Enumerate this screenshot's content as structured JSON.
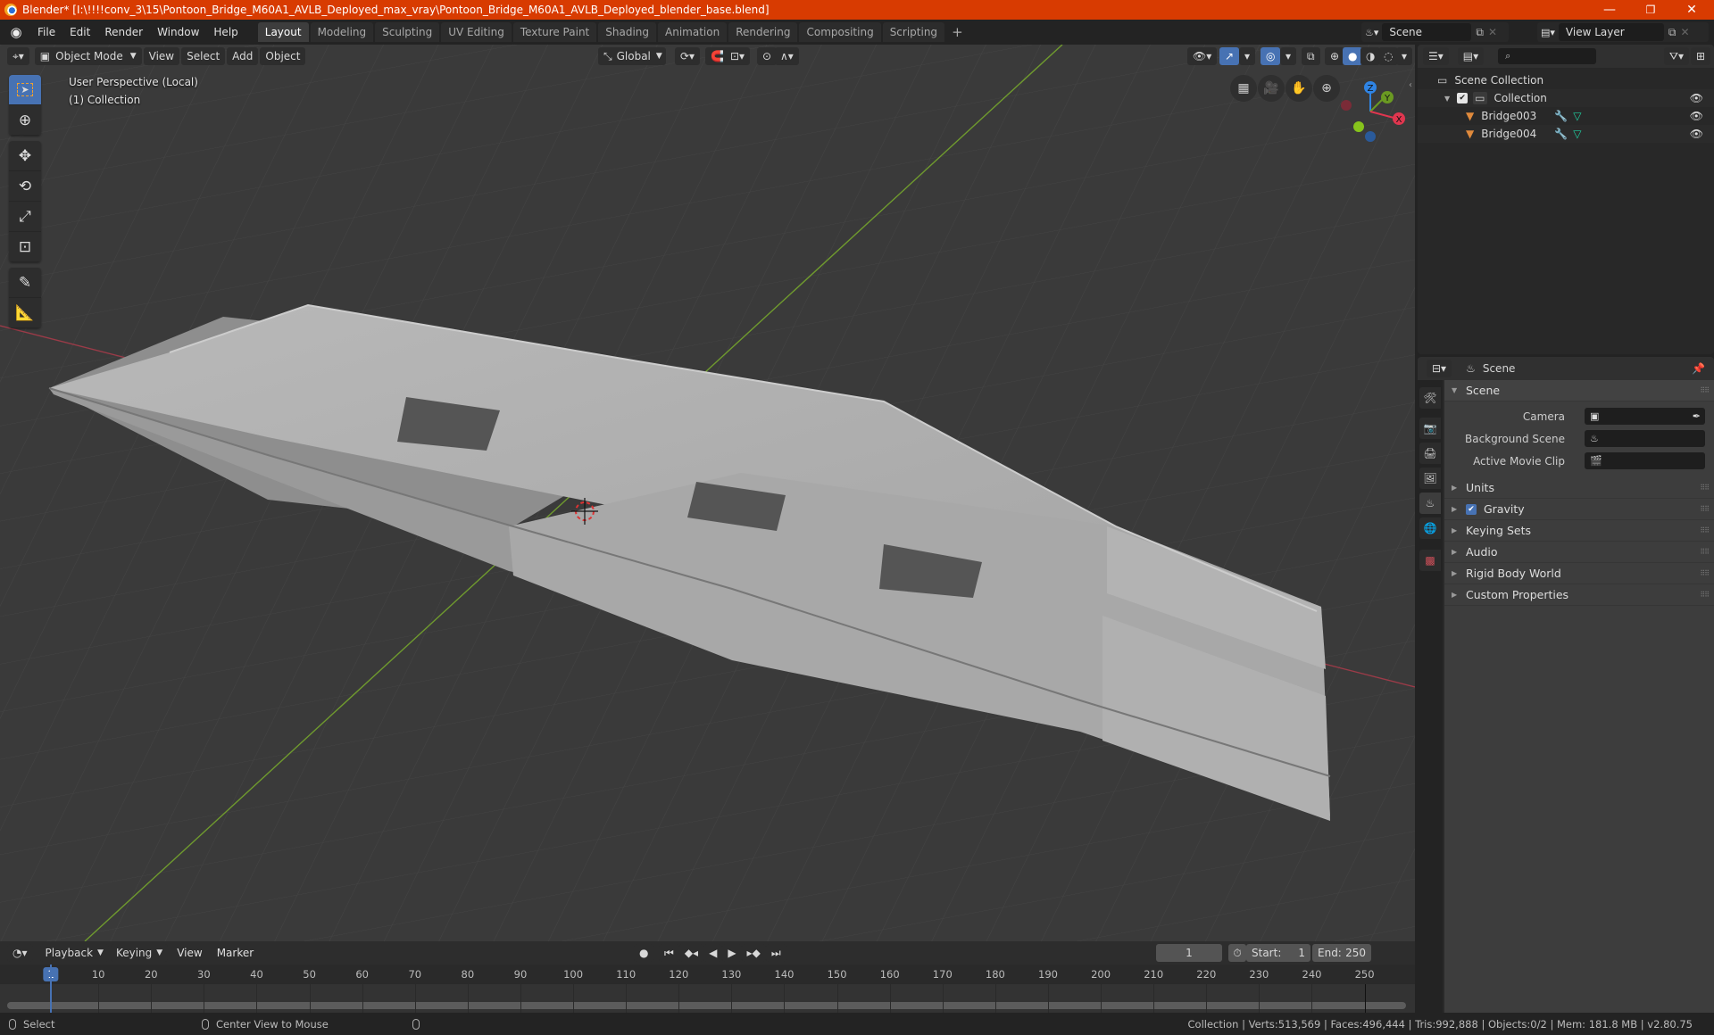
{
  "window": {
    "title": "Blender* [I:\\!!!!conv_3\\15\\Pontoon_Bridge_M60A1_AVLB_Deployed_max_vray\\Pontoon_Bridge_M60A1_AVLB_Deployed_blender_base.blend]",
    "controls": {
      "minimize": "—",
      "maximize": "❐",
      "close": "✕"
    }
  },
  "menubar": {
    "items": [
      "File",
      "Edit",
      "Render",
      "Window",
      "Help"
    ],
    "workspaces": [
      "Layout",
      "Modeling",
      "Sculpting",
      "UV Editing",
      "Texture Paint",
      "Shading",
      "Animation",
      "Rendering",
      "Compositing",
      "Scripting"
    ],
    "active_workspace": "Layout",
    "add_workspace": "+",
    "scene": "Scene",
    "view_layer": "View Layer"
  },
  "viewport": {
    "header": {
      "mode": "Object Mode",
      "menus": [
        "View",
        "Select",
        "Add",
        "Object"
      ],
      "transform_orientation": "Global"
    },
    "overlay": {
      "view_name": "User Perspective (Local)",
      "collection": "(1) Collection"
    },
    "gizmo": {
      "x": "X",
      "y": "Y",
      "z": "Z"
    },
    "accent": "#4772b3"
  },
  "tools": [
    {
      "name": "select-box",
      "active": true
    },
    {
      "name": "cursor"
    },
    {
      "name": "move"
    },
    {
      "name": "rotate"
    },
    {
      "name": "scale"
    },
    {
      "name": "transform"
    },
    {
      "name": "annotate"
    },
    {
      "name": "measure"
    }
  ],
  "outliner": {
    "search_placeholder": "",
    "root": "Scene Collection",
    "collection": "Collection",
    "objects": [
      {
        "name": "Bridge003"
      },
      {
        "name": "Bridge004"
      }
    ]
  },
  "properties": {
    "context": "Scene",
    "panel_title": "Scene",
    "fields": [
      {
        "label": "Camera",
        "value": ""
      },
      {
        "label": "Background Scene",
        "value": ""
      },
      {
        "label": "Active Movie Clip",
        "value": ""
      }
    ],
    "collapsed_panels": [
      "Units",
      "Gravity",
      "Keying Sets",
      "Audio",
      "Rigid Body World",
      "Custom Properties"
    ],
    "gravity_enabled": true
  },
  "timeline": {
    "menus": [
      "Playback",
      "Keying",
      "View",
      "Marker"
    ],
    "current_frame": "1",
    "start_label": "Start:",
    "start": "1",
    "end_label": "End:",
    "end": "250",
    "ruler": [
      "1",
      "10",
      "20",
      "30",
      "40",
      "50",
      "60",
      "70",
      "80",
      "90",
      "100",
      "110",
      "120",
      "130",
      "140",
      "150",
      "160",
      "170",
      "180",
      "190",
      "200",
      "210",
      "220",
      "230",
      "240",
      "250"
    ]
  },
  "statusbar": {
    "left_hint": "Select",
    "middle_hint": "Center View to Mouse",
    "stats": "Collection | Verts:513,569 | Faces:496,444 | Tris:992,888 | Objects:0/2 | Mem: 181.8 MB | v2.80.75"
  }
}
